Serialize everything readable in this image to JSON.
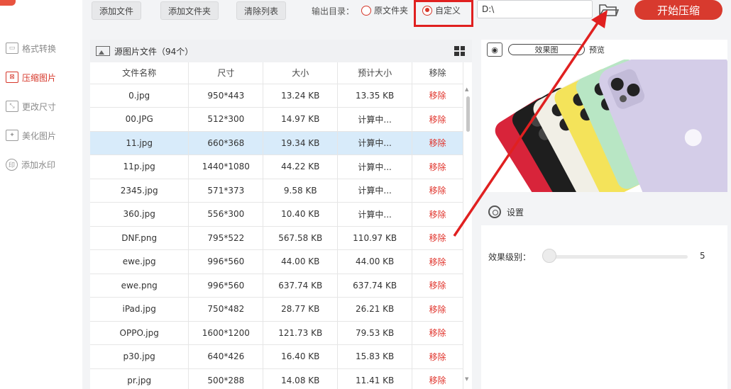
{
  "sidebar": {
    "items": [
      {
        "label": "格式转换",
        "icon": "convert-icon",
        "glyph": "▭"
      },
      {
        "label": "压缩图片",
        "icon": "compress-icon",
        "glyph": "⊠"
      },
      {
        "label": "更改尺寸",
        "icon": "resize-icon",
        "glyph": "⤡"
      },
      {
        "label": "美化图片",
        "icon": "beautify-icon",
        "glyph": "✦"
      },
      {
        "label": "添加水印",
        "icon": "watermark-icon",
        "glyph": "印"
      }
    ]
  },
  "toolbar": {
    "add_file": "添加文件",
    "add_folder": "添加文件夹",
    "clear_list": "清除列表",
    "output_label": "输出目录：",
    "radio_original": "原文件夹",
    "radio_custom": "自定义",
    "path_value": "D:\\",
    "start_button": "开始压缩"
  },
  "file_panel": {
    "title": "源图片文件（94个）",
    "columns": [
      "文件名称",
      "尺寸",
      "大小",
      "预计大小",
      "移除"
    ],
    "rows": [
      {
        "name": "0.jpg",
        "size": "950*443",
        "bytes": "13.24 KB",
        "est": "13.35 KB",
        "remove": "移除"
      },
      {
        "name": "00.JPG",
        "size": "512*300",
        "bytes": "14.97 KB",
        "est": "计算中...",
        "remove": "移除"
      },
      {
        "name": "11.jpg",
        "size": "660*368",
        "bytes": "19.34 KB",
        "est": "计算中...",
        "remove": "移除"
      },
      {
        "name": "11p.jpg",
        "size": "1440*1080",
        "bytes": "44.22 KB",
        "est": "计算中...",
        "remove": "移除"
      },
      {
        "name": "2345.jpg",
        "size": "571*373",
        "bytes": "9.58 KB",
        "est": "计算中...",
        "remove": "移除"
      },
      {
        "name": "360.jpg",
        "size": "556*300",
        "bytes": "10.40 KB",
        "est": "计算中...",
        "remove": "移除"
      },
      {
        "name": "DNF.png",
        "size": "795*522",
        "bytes": "567.58 KB",
        "est": "110.97 KB",
        "remove": "移除"
      },
      {
        "name": "ewe.jpg",
        "size": "996*560",
        "bytes": "44.00 KB",
        "est": "44.00 KB",
        "remove": "移除"
      },
      {
        "name": "ewe.png",
        "size": "996*560",
        "bytes": "637.74 KB",
        "est": "637.74 KB",
        "remove": "移除"
      },
      {
        "name": "iPad.jpg",
        "size": "750*482",
        "bytes": "28.77 KB",
        "est": "26.21 KB",
        "remove": "移除"
      },
      {
        "name": "OPPO.jpg",
        "size": "1600*1200",
        "bytes": "121.73 KB",
        "est": "79.53 KB",
        "remove": "移除"
      },
      {
        "name": "p30.jpg",
        "size": "640*426",
        "bytes": "16.40 KB",
        "est": "15.83 KB",
        "remove": "移除"
      },
      {
        "name": "pr.jpg",
        "size": "500*288",
        "bytes": "14.08 KB",
        "est": "11.41 KB",
        "remove": "移除"
      }
    ]
  },
  "preview": {
    "effect_label": "效果图",
    "preview_label": "预览"
  },
  "settings": {
    "title": "设置",
    "level_label": "效果级别：",
    "level_value": "5"
  },
  "colors": {
    "accent": "#d83a2e",
    "selected_row": "#d8ebfa",
    "annotation_red": "#e02020"
  }
}
